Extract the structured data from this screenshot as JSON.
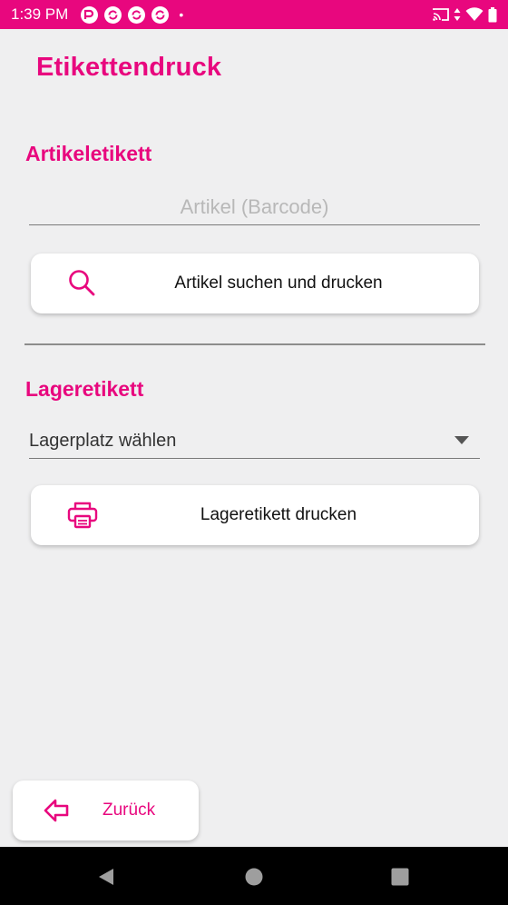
{
  "status_bar": {
    "time": "1:39 PM",
    "notification_icons": [
      "app-notification-icon",
      "sync-icon",
      "sync-icon",
      "sync-icon"
    ],
    "more_dot": "•",
    "system_icons": [
      "cast-icon",
      "data-arrows-icon",
      "wifi-icon",
      "battery-icon"
    ]
  },
  "app_title": "Etikettendruck",
  "article_section": {
    "title": "Artikeletikett",
    "barcode_placeholder": "Artikel (Barcode)",
    "barcode_value": "",
    "search_button_label": "Artikel suchen und drucken",
    "search_button_icon": "search-icon"
  },
  "storage_section": {
    "title": "Lageretikett",
    "location_spinner_value": "Lagerplatz wählen",
    "print_button_label": "Lageretikett drucken",
    "print_button_icon": "printer-icon"
  },
  "back_button": {
    "label": "Zurück",
    "icon": "arrow-left-icon"
  },
  "colors": {
    "accent": "#e8077e",
    "background": "#efeff0",
    "card": "#ffffff",
    "nav_bar": "#000000"
  }
}
